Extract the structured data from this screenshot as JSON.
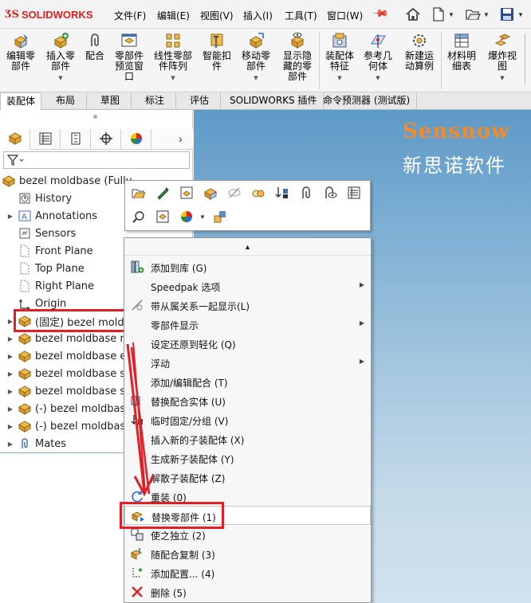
{
  "app": {
    "logo_ds": "ƷS",
    "logo_text": "SOLIDWORKS"
  },
  "menu": [
    {
      "label": "文件(F)"
    },
    {
      "label": "编辑(E)"
    },
    {
      "label": "视图(V)"
    },
    {
      "label": "插入(I)"
    },
    {
      "label": "工具(T)"
    },
    {
      "label": "窗口(W)"
    }
  ],
  "quick_access": [
    "home-icon",
    "new-document-icon",
    "open-folder-icon",
    "save-icon"
  ],
  "ribbon": [
    {
      "label": "编辑零\n部件",
      "icon": "edit-component-icon",
      "has_dropdown": false
    },
    {
      "label": "插入零\n部件",
      "icon": "insert-component-icon",
      "has_dropdown": true
    },
    {
      "label": "配合",
      "icon": "mate-icon",
      "has_dropdown": false
    },
    {
      "label": "零部件\n预览窗\n口",
      "icon": "component-preview-icon",
      "has_dropdown": false
    },
    {
      "label": "线性零部\n件阵列",
      "icon": "linear-pattern-icon",
      "has_dropdown": true
    },
    {
      "label": "智能扣\n件",
      "icon": "smart-fasteners-icon",
      "has_dropdown": false
    },
    {
      "label": "移动零\n部件",
      "icon": "move-component-icon",
      "has_dropdown": true
    },
    {
      "label": "显示隐\n藏的零\n部件",
      "icon": "show-hidden-icon",
      "has_dropdown": false
    },
    {
      "label": "装配体\n特征",
      "icon": "assembly-features-icon",
      "has_dropdown": true
    },
    {
      "label": "参考几\n何体",
      "icon": "reference-geometry-icon",
      "has_dropdown": true
    },
    {
      "label": "新建运\n动算例",
      "icon": "new-motion-study-icon",
      "has_dropdown": false
    },
    {
      "label": "材料明\n细表",
      "icon": "bom-icon",
      "has_dropdown": false
    },
    {
      "label": "爆炸视\n图",
      "icon": "exploded-view-icon",
      "has_dropdown": true
    }
  ],
  "tabs": [
    {
      "label": "装配体",
      "active": true
    },
    {
      "label": "布局"
    },
    {
      "label": "草图"
    },
    {
      "label": "标注"
    },
    {
      "label": "评估"
    },
    {
      "label": "SOLIDWORKS 插件"
    },
    {
      "label": "命令预测器 (测试版)"
    }
  ],
  "feature_manager_tabs": [
    "feature-manager-icon",
    "property-manager-icon",
    "configuration-manager-icon",
    "dimxpert-icon",
    "display-manager-icon"
  ],
  "tree": [
    {
      "label": "bezel moldbase (Fully",
      "icon": "assembly-icon",
      "expand": false,
      "indent": 0
    },
    {
      "label": "History",
      "icon": "history-icon",
      "expand": false,
      "indent": 1
    },
    {
      "label": "Annotations",
      "icon": "annotations-icon",
      "expand": true,
      "indent": 1
    },
    {
      "label": "Sensors",
      "icon": "sensors-icon",
      "expand": false,
      "indent": 1
    },
    {
      "label": "Front Plane",
      "icon": "plane-icon",
      "expand": false,
      "indent": 1
    },
    {
      "label": "Top Plane",
      "icon": "plane-icon",
      "expand": false,
      "indent": 1
    },
    {
      "label": "Right Plane",
      "icon": "plane-icon",
      "expand": false,
      "indent": 1
    },
    {
      "label": "Origin",
      "icon": "origin-icon",
      "expand": false,
      "indent": 1
    },
    {
      "label": "(固定) bezel moldb",
      "icon": "part-icon",
      "expand": true,
      "indent": 1,
      "selected": true
    },
    {
      "label": "bezel moldbase m",
      "icon": "part-icon",
      "expand": true,
      "indent": 1
    },
    {
      "label": "bezel moldbase e",
      "icon": "part-icon",
      "expand": true,
      "indent": 1
    },
    {
      "label": "bezel moldbase si",
      "icon": "part-icon",
      "expand": true,
      "indent": 1
    },
    {
      "label": "bezel moldbase si",
      "icon": "part-icon",
      "expand": true,
      "indent": 1
    },
    {
      "label": "(-) bezel moldbase",
      "icon": "part-icon",
      "expand": true,
      "indent": 1
    },
    {
      "label": "(-) bezel moldbase",
      "icon": "part-icon",
      "expand": true,
      "indent": 1
    },
    {
      "label": "Mates",
      "icon": "mates-icon",
      "expand": true,
      "indent": 1
    }
  ],
  "context_toolbar": {
    "row1": [
      "open-part-icon",
      "edit-part-icon",
      "component-properties-icon",
      "edit-component-icon",
      "hide-components-icon",
      "isolate-icon",
      "fixed-icon",
      "mate-icon",
      "view-mates-icon",
      "feature-list-icon"
    ],
    "row2": [
      "zoom-to-selection-icon",
      "make-independent-icon",
      "appearance-icon",
      "suppress-icon"
    ]
  },
  "context_menu": [
    {
      "label": "添加到库 (G)",
      "icon": "add-to-library-icon",
      "submenu": false
    },
    {
      "label": "Speedpak 选项",
      "icon": "",
      "submenu": true
    },
    {
      "label": "带从属关系一起显示(L)",
      "icon": "show-with-dependents-icon",
      "submenu": false
    },
    {
      "label": "零部件显示",
      "icon": "",
      "submenu": true
    },
    {
      "label": "设定还原到轻化 (Q)",
      "icon": "",
      "submenu": false
    },
    {
      "label": "浮动",
      "icon": "",
      "submenu": true
    },
    {
      "label": "添加/编辑配合 (T)",
      "icon": "",
      "submenu": false
    },
    {
      "label": "替换配合实体 (U)",
      "icon": "replace-mate-entities-icon",
      "submenu": false
    },
    {
      "label": "临时固定/分组 (V)",
      "icon": "temp-fix-icon",
      "submenu": false
    },
    {
      "label": "插入新的子装配体 (X)",
      "icon": "",
      "submenu": false
    },
    {
      "label": "生成新子装配体 (Y)",
      "icon": "",
      "submenu": false
    },
    {
      "label": "解散子装配体 (Z)",
      "icon": "",
      "submenu": false
    },
    {
      "label": "重装 (0)",
      "icon": "reload-icon",
      "submenu": false
    },
    {
      "label": "替换零部件 (1)",
      "icon": "replace-components-icon",
      "submenu": false,
      "highlighted": true
    },
    {
      "label": "使之独立 (2)",
      "icon": "make-independent-icon",
      "submenu": false
    },
    {
      "label": "随配合复制 (3)",
      "icon": "copy-with-mates-icon",
      "submenu": false
    },
    {
      "label": "添加配置... (4)",
      "icon": "add-configuration-icon",
      "submenu": false
    },
    {
      "label": "删除 (5)",
      "icon": "delete-icon",
      "submenu": false
    }
  ],
  "watermark": {
    "en": "Sensnow",
    "cn": "新思诺软件"
  },
  "colors": {
    "brand_red": "#d8221c",
    "annotation_red": "#e21f26",
    "watermark_orange": "#f28a2a"
  }
}
